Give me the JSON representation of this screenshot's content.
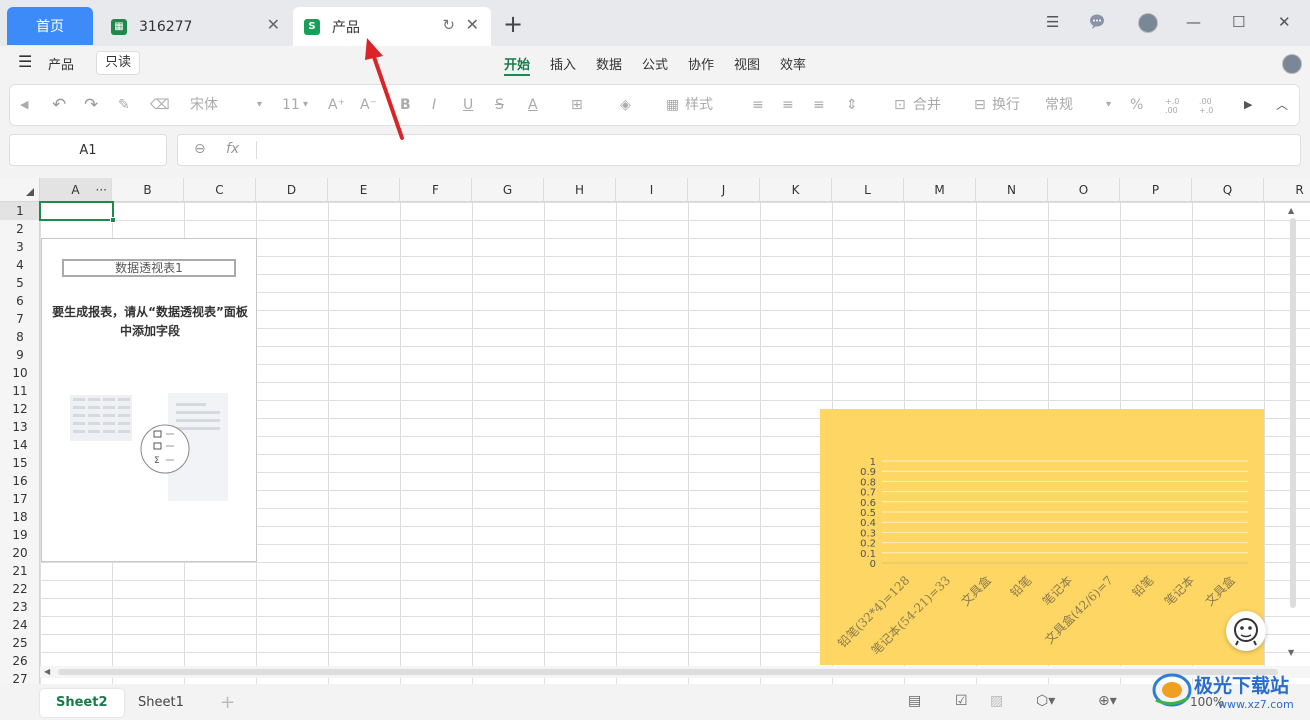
{
  "titlebar": {
    "home_tab": "首页",
    "tabs": [
      {
        "label": "316277",
        "icon": "spreadsheet-icon"
      },
      {
        "label": "产品",
        "icon": "sheet-s-icon",
        "icon_letter": "S"
      }
    ],
    "new_tab_icon": "plus-icon"
  },
  "menubar": {
    "doc_name": "产品",
    "readonly_label": "只读",
    "items": [
      "开始",
      "插入",
      "数据",
      "公式",
      "协作",
      "视图",
      "效率"
    ],
    "active_item": "开始"
  },
  "toolbar": {
    "font_name": "宋体",
    "font_size": "11",
    "style_label": "样式",
    "merge_label": "合并",
    "wrap_label": "换行",
    "number_format": "常规",
    "percent": "%",
    "dec_inc": "+.0 .00",
    "dec_dec": ".00 +.0",
    "bold": "B",
    "italic": "I",
    "underline": "U"
  },
  "formulabar": {
    "cell_ref": "A1",
    "fx_label": "fx"
  },
  "grid": {
    "columns": [
      "A",
      "B",
      "C",
      "D",
      "E",
      "F",
      "G",
      "H",
      "I",
      "J",
      "K",
      "L",
      "M",
      "N",
      "O",
      "P",
      "Q",
      "R"
    ],
    "rows": [
      "1",
      "2",
      "3",
      "4",
      "5",
      "6",
      "7",
      "8",
      "9",
      "10",
      "11",
      "12",
      "13",
      "14",
      "15",
      "16",
      "17",
      "18",
      "19",
      "20",
      "21",
      "22",
      "23",
      "24",
      "25",
      "26",
      "27"
    ],
    "selected_cell": "A1"
  },
  "pivot": {
    "title": "数据透视表1",
    "message": "要生成报表，请从“数据透视表”面板中添加字段"
  },
  "chart_data": {
    "type": "bar",
    "categories": [
      "铅笔(32*4)=128",
      "笔记本(54-21)=33",
      "文具盒",
      "铅笔",
      "笔记本",
      "文具盒(42/6)=7",
      "铅笔",
      "笔记本",
      "文具盒"
    ],
    "values": [
      0,
      0,
      0,
      0,
      0,
      0,
      0,
      0,
      0
    ],
    "ylim": [
      0,
      1
    ],
    "yticks": [
      "0",
      "0.1",
      "0.2",
      "0.3",
      "0.4",
      "0.5",
      "0.6",
      "0.7",
      "0.8",
      "0.9",
      "1"
    ],
    "grid": true,
    "background": "#fdd663"
  },
  "sheets": {
    "tabs": [
      "Sheet2",
      "Sheet1"
    ],
    "active": "Sheet2",
    "zoom": "100%"
  },
  "watermark": {
    "text": "极光下载站",
    "url_text": "www.xz7.com"
  },
  "colors": {
    "accent": "#1b7a4a",
    "home_tab": "#3d8bf8",
    "arrow": "#d9252a"
  }
}
